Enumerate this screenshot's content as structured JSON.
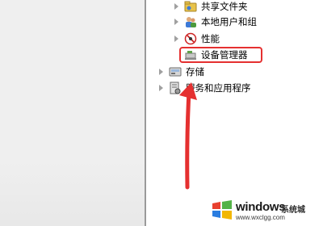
{
  "tree": {
    "items": [
      {
        "label": "共享文件夹",
        "icon": "shared-folder-icon"
      },
      {
        "label": "本地用户和组",
        "icon": "users-groups-icon"
      },
      {
        "label": "性能",
        "icon": "performance-icon"
      },
      {
        "label": "设备管理器",
        "icon": "device-manager-icon"
      },
      {
        "label": "存储",
        "icon": "storage-icon"
      },
      {
        "label": "服务和应用程序",
        "icon": "services-apps-icon"
      }
    ]
  },
  "watermark": {
    "brand": "windows",
    "sub": "系统城",
    "url": "www.wxclgg.com"
  },
  "colors": {
    "highlight_border": "#e53030",
    "arrow": "#e53030",
    "divider": "#9a9a9a"
  }
}
